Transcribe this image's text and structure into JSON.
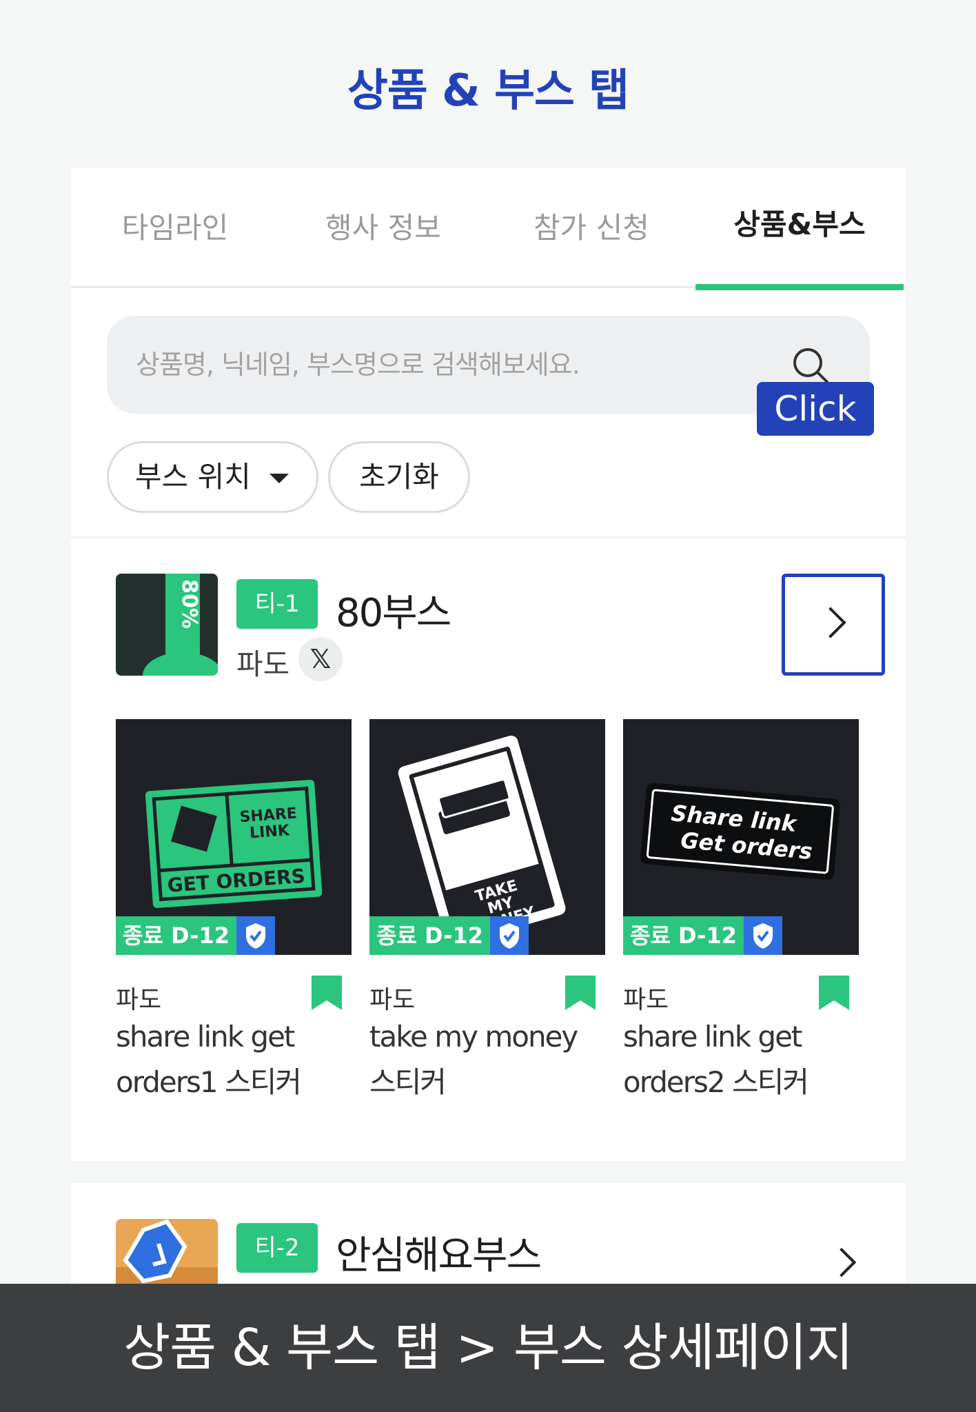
{
  "page_title": "상품 & 부스 탭",
  "tabs": [
    {
      "label": "타임라인"
    },
    {
      "label": "행사 정보"
    },
    {
      "label": "참가 신청"
    },
    {
      "label": "상품&부스"
    }
  ],
  "search": {
    "placeholder": "상품명, 닉네임, 부스명으로 검색해보세요."
  },
  "filters": {
    "location_label": "부스 위치",
    "reset_label": "초기화"
  },
  "booths": [
    {
      "tag": "티-1",
      "name": "80부스",
      "owner": "파도",
      "x_label": "𝕏",
      "thumb_text": "80%",
      "click_label": "Click",
      "products": [
        {
          "badge": "종료 D-12",
          "seller": "파도",
          "title": "share link get orders1 스티커",
          "art": {
            "line1": "SHARE",
            "line2": "LINK",
            "line3": "GET ORDERS"
          }
        },
        {
          "badge": "종료 D-12",
          "seller": "파도",
          "title": "take my money 스티커",
          "art": {
            "line1": "TAKE",
            "line2": "MY",
            "line3": "MONEY"
          }
        },
        {
          "badge": "종료 D-12",
          "seller": "파도",
          "title": "share link get orders2 스티커",
          "art": {
            "line1": "Share link",
            "line2": "Get orders"
          }
        }
      ]
    },
    {
      "tag": "티-2",
      "name": "안심해요부스"
    }
  ],
  "footer_caption": "상품 & 부스 탭 > 부스 상세페이지",
  "colors": {
    "accent_green": "#2bc57d",
    "accent_blue": "#2342b8",
    "badge_blue": "#2f6fe0",
    "bar_dark": "#3d3e40"
  }
}
